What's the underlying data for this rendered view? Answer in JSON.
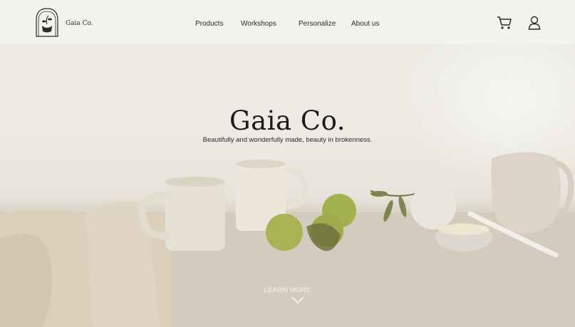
{
  "header": {
    "brand_name": "Gaia Co.",
    "nav": [
      "Products",
      "Workshops",
      "Personalize",
      "About us"
    ],
    "icons": [
      "cart-icon",
      "user-icon"
    ]
  },
  "hero": {
    "title": "Gaia Co.",
    "subtitle": "Beautifully and wonderfully made, beauty in brokenness.",
    "cta": "LEARN MORE"
  },
  "colors": {
    "text": "#1d1b18",
    "header_bg": "#f6f4f0",
    "cta": "#f7f5f0"
  }
}
